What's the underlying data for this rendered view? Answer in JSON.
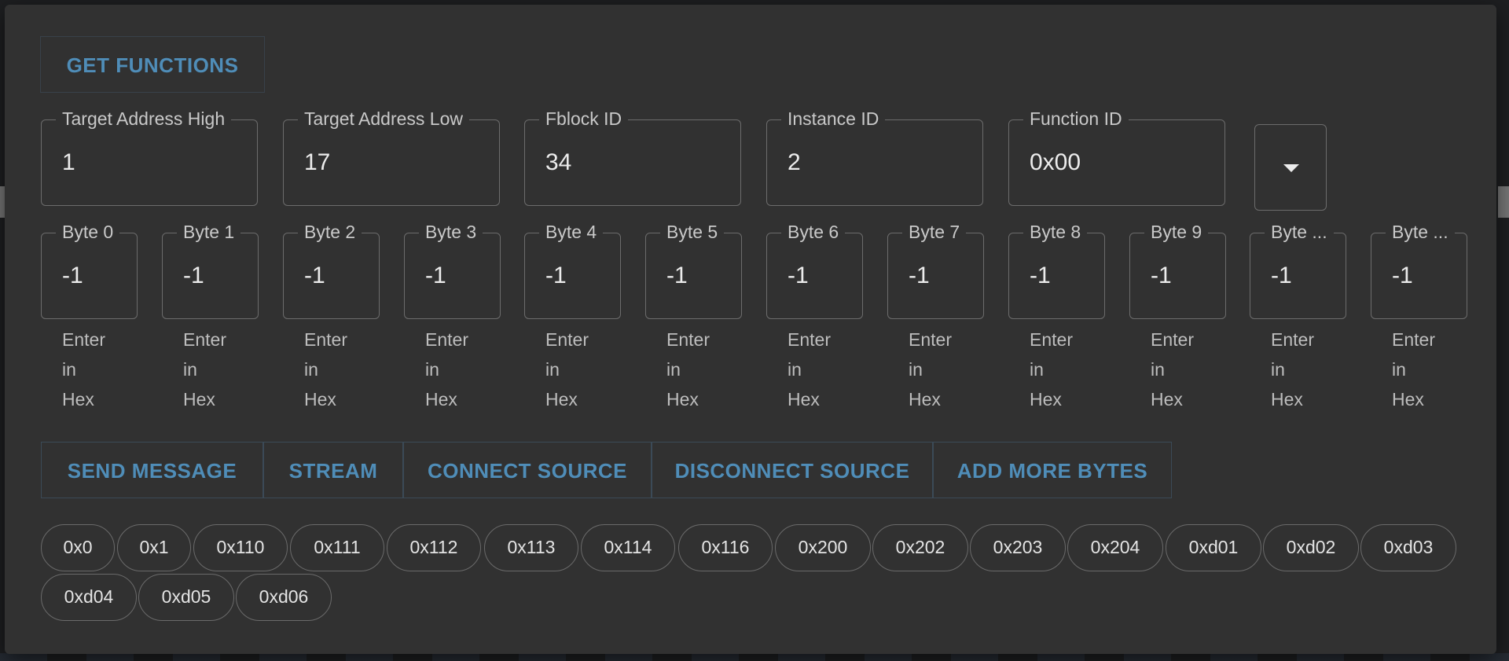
{
  "header": {
    "get_functions_label": "GET FUNCTIONS"
  },
  "fields": [
    {
      "label": "Target Address High",
      "value": "1"
    },
    {
      "label": "Target Address Low",
      "value": "17"
    },
    {
      "label": "Fblock ID",
      "value": "34"
    },
    {
      "label": "Instance ID",
      "value": "2"
    },
    {
      "label": "Function ID",
      "value": "0x00"
    }
  ],
  "bytes": [
    {
      "label": "Byte 0",
      "value": "-1",
      "helper": "Enter\nin\nHex"
    },
    {
      "label": "Byte 1",
      "value": "-1",
      "helper": "Enter\nin\nHex"
    },
    {
      "label": "Byte 2",
      "value": "-1",
      "helper": "Enter\nin\nHex"
    },
    {
      "label": "Byte 3",
      "value": "-1",
      "helper": "Enter\nin\nHex"
    },
    {
      "label": "Byte 4",
      "value": "-1",
      "helper": "Enter\nin\nHex"
    },
    {
      "label": "Byte 5",
      "value": "-1",
      "helper": "Enter\nin\nHex"
    },
    {
      "label": "Byte 6",
      "value": "-1",
      "helper": "Enter\nin\nHex"
    },
    {
      "label": "Byte 7",
      "value": "-1",
      "helper": "Enter\nin\nHex"
    },
    {
      "label": "Byte 8",
      "value": "-1",
      "helper": "Enter\nin\nHex"
    },
    {
      "label": "Byte 9",
      "value": "-1",
      "helper": "Enter\nin\nHex"
    },
    {
      "label": "Byte ...",
      "value": "-1",
      "helper": "Enter\nin\nHex"
    },
    {
      "label": "Byte ...",
      "value": "-1",
      "helper": "Enter\nin\nHex"
    }
  ],
  "actions": {
    "send_message": "SEND MESSAGE",
    "stream": "STREAM",
    "connect_source": "CONNECT SOURCE",
    "disconnect_source": "DISCONNECT SOURCE",
    "add_more_bytes": "ADD MORE BYTES"
  },
  "chips": [
    "0x0",
    "0x1",
    "0x110",
    "0x111",
    "0x112",
    "0x113",
    "0x114",
    "0x116",
    "0x200",
    "0x202",
    "0x203",
    "0x204",
    "0xd01",
    "0xd02",
    "0xd03",
    "0xd04",
    "0xd05",
    "0xd06"
  ],
  "colors": {
    "panel": "#313131",
    "accent": "#4f8db8",
    "outline": "#6c6c6c",
    "text": "#ececec"
  },
  "icons": {
    "dropdown": "chevron-down-icon"
  }
}
